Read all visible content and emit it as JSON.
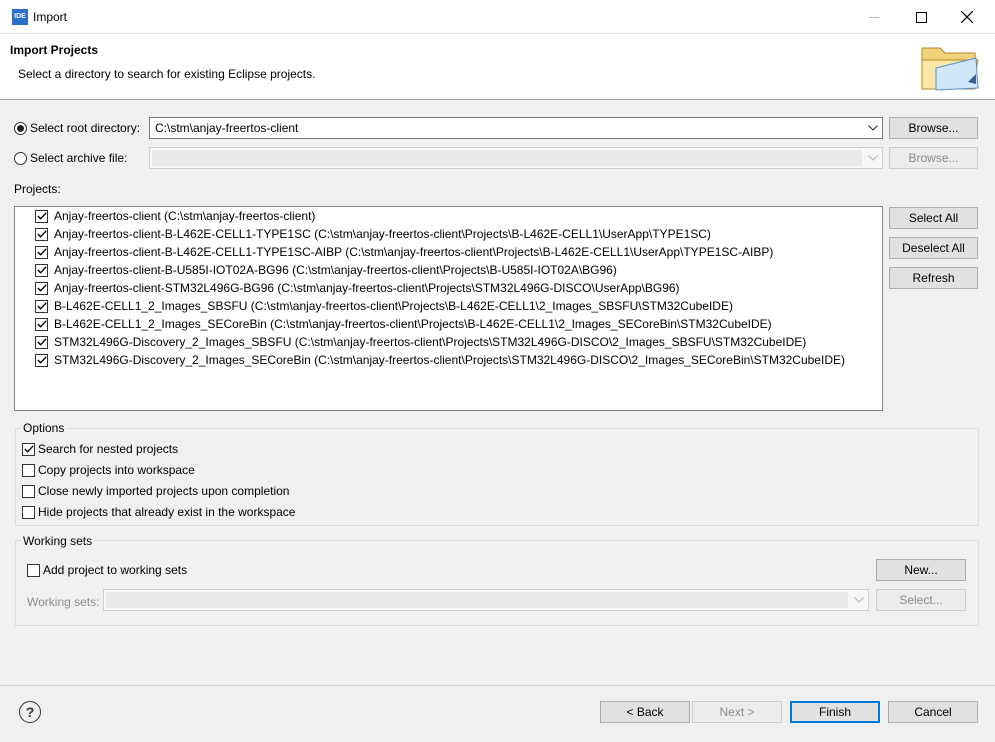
{
  "window": {
    "app_icon_text": "IDE",
    "title": "Import",
    "controls": [
      "minimize",
      "maximize",
      "close"
    ]
  },
  "header": {
    "title": "Import Projects",
    "description": "Select a directory to search for existing Eclipse projects.",
    "icon": "folder-icon"
  },
  "source": {
    "root_directory": {
      "label": "Select root directory:",
      "selected": true,
      "value": "C:\\stm\\anjay-freertos-client",
      "browse_label": "Browse..."
    },
    "archive_file": {
      "label": "Select archive file:",
      "selected": false,
      "value": "",
      "browse_label": "Browse..."
    }
  },
  "projects": {
    "label": "Projects:",
    "items": [
      {
        "text": "Anjay-freertos-client (C:\\stm\\anjay-freertos-client)",
        "checked": true
      },
      {
        "text": "Anjay-freertos-client-B-L462E-CELL1-TYPE1SC (C:\\stm\\anjay-freertos-client\\Projects\\B-L462E-CELL1\\UserApp\\TYPE1SC)",
        "checked": true
      },
      {
        "text": "Anjay-freertos-client-B-L462E-CELL1-TYPE1SC-AIBP (C:\\stm\\anjay-freertos-client\\Projects\\B-L462E-CELL1\\UserApp\\TYPE1SC-AIBP)",
        "checked": true
      },
      {
        "text": "Anjay-freertos-client-B-U585I-IOT02A-BG96 (C:\\stm\\anjay-freertos-client\\Projects\\B-U585I-IOT02A\\BG96)",
        "checked": true
      },
      {
        "text": "Anjay-freertos-client-STM32L496G-BG96 (C:\\stm\\anjay-freertos-client\\Projects\\STM32L496G-DISCO\\UserApp\\BG96)",
        "checked": true
      },
      {
        "text": "B-L462E-CELL1_2_Images_SBSFU (C:\\stm\\anjay-freertos-client\\Projects\\B-L462E-CELL1\\2_Images_SBSFU\\STM32CubeIDE)",
        "checked": true
      },
      {
        "text": "B-L462E-CELL1_2_Images_SECoreBin (C:\\stm\\anjay-freertos-client\\Projects\\B-L462E-CELL1\\2_Images_SECoreBin\\STM32CubeIDE)",
        "checked": true
      },
      {
        "text": "STM32L496G-Discovery_2_Images_SBSFU (C:\\stm\\anjay-freertos-client\\Projects\\STM32L496G-DISCO\\2_Images_SBSFU\\STM32CubeIDE)",
        "checked": true
      },
      {
        "text": "STM32L496G-Discovery_2_Images_SECoreBin (C:\\stm\\anjay-freertos-client\\Projects\\STM32L496G-DISCO\\2_Images_SECoreBin\\STM32CubeIDE)",
        "checked": true
      }
    ],
    "buttons": {
      "select_all": "Select All",
      "deselect_all": "Deselect All",
      "refresh": "Refresh"
    }
  },
  "options": {
    "label": "Options",
    "items": [
      {
        "text": "Search for nested projects",
        "checked": true
      },
      {
        "text": "Copy projects into workspace",
        "checked": false
      },
      {
        "text": "Close newly imported projects upon completion",
        "checked": false
      },
      {
        "text": "Hide projects that already exist in the workspace",
        "checked": false
      }
    ]
  },
  "working_sets": {
    "label": "Working sets",
    "add_label": "Add project to working sets",
    "add_checked": false,
    "new_label": "New...",
    "sets_label": "Working sets:",
    "sets_value": "",
    "select_label": "Select..."
  },
  "footer": {
    "help_glyph": "?",
    "back": "< Back",
    "next": "Next >",
    "finish": "Finish",
    "cancel": "Cancel"
  },
  "colors": {
    "accent": "#0078d7",
    "window_bg": "#f0f0f0"
  }
}
